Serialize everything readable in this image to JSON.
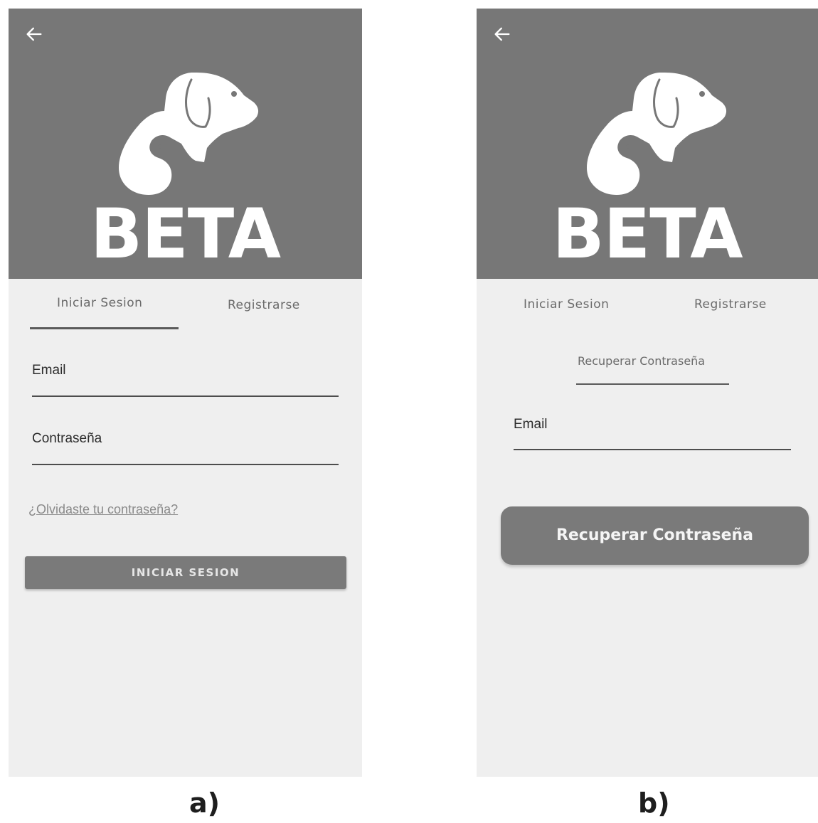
{
  "brand": {
    "name": "BETA"
  },
  "screen_a": {
    "tabs": {
      "login": "Iniciar Sesion",
      "register": "Registrarse"
    },
    "email": {
      "label": "Email"
    },
    "password": {
      "label": "Contraseña"
    },
    "forgot_link": "¿Olvidaste tu contraseña?",
    "login_button": "INICIAR SESION",
    "caption": "a)"
  },
  "screen_b": {
    "tabs": {
      "login": "Iniciar Sesion",
      "register": "Registrarse"
    },
    "section_title": "Recuperar Contraseña",
    "email": {
      "label": "Email"
    },
    "recover_button": "Recuperar Contraseña",
    "caption": "b)"
  },
  "colors": {
    "header": "#777777",
    "background": "#efefef",
    "button": "#7a7a7a",
    "underline": "#5a5a5a"
  },
  "icons": {
    "back": "back-arrow-icon",
    "logo": "dog-cat-logo-icon"
  }
}
